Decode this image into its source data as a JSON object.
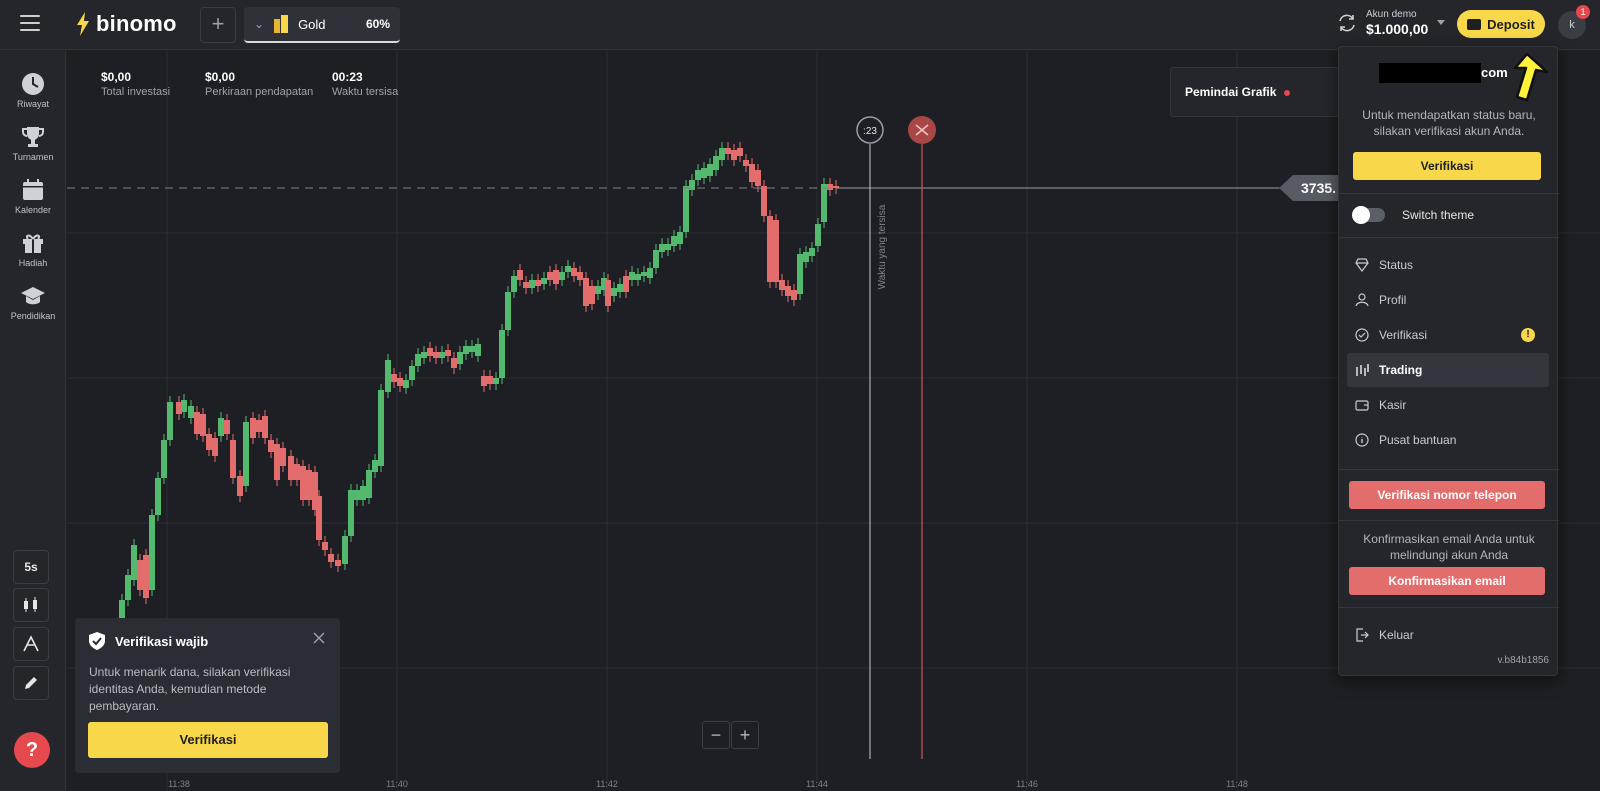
{
  "header": {
    "logo_text": "binomo",
    "add_symbol": "+",
    "asset": {
      "name": "Gold",
      "payout": "60%"
    },
    "account": {
      "label": "Akun demo",
      "balance": "$1.000,00"
    },
    "deposit_label": "Deposit",
    "avatar_initial": "k",
    "notification_count": "1"
  },
  "sidebar": {
    "items": [
      {
        "label": "Riwayat",
        "icon": "clock-icon"
      },
      {
        "label": "Turnamen",
        "icon": "trophy-icon"
      },
      {
        "label": "Kalender",
        "icon": "calendar-icon"
      },
      {
        "label": "Hadiah",
        "icon": "gift-icon"
      },
      {
        "label": "Pendidikan",
        "icon": "graduation-cap-icon"
      }
    ],
    "timeframe": "5s",
    "help": "?"
  },
  "stats": [
    {
      "value": "$0,00",
      "label": "Total investasi"
    },
    {
      "value": "$0,00",
      "label": "Perkiraan pendapatan"
    },
    {
      "value": "00:23",
      "label": "Waktu tersisa"
    }
  ],
  "chart": {
    "scanner_label": "Pemindai Grafik",
    "timer_badge": ":23",
    "remaining_label": "Waktu yang tersisa",
    "price_tag": "3735.",
    "x_ticks": [
      "11:38",
      "11:40",
      "11:42",
      "11:44",
      "11:46",
      "11:48"
    ],
    "colors": {
      "up": "#52b96f",
      "down": "#e36c6c"
    }
  },
  "toast": {
    "title": "Verifikasi wajib",
    "body": "Untuk menarik dana, silakan verifikasi identitas Anda, kemudian metode pembayaran.",
    "button": "Verifikasi"
  },
  "panel": {
    "email_suffix": "com",
    "status_info": "Untuk mendapatkan status baru, silakan verifikasi akun Anda.",
    "verify_button": "Verifikasi",
    "switch_theme": "Switch theme",
    "menu": [
      {
        "label": "Status",
        "icon": "diamond-icon"
      },
      {
        "label": "Profil",
        "icon": "user-icon"
      },
      {
        "label": "Verifikasi",
        "icon": "check-circle-icon"
      },
      {
        "label": "Trading",
        "icon": "candles-icon"
      },
      {
        "label": "Kasir",
        "icon": "wallet-icon"
      },
      {
        "label": "Pusat bantuan",
        "icon": "info-icon"
      }
    ],
    "phone_button": "Verifikasi nomor telepon",
    "email_info": "Konfirmasikan email Anda untuk melindungi akun Anda",
    "email_button": "Konfirmasikan email",
    "logout": "Keluar",
    "version": "v.b84b1856"
  }
}
